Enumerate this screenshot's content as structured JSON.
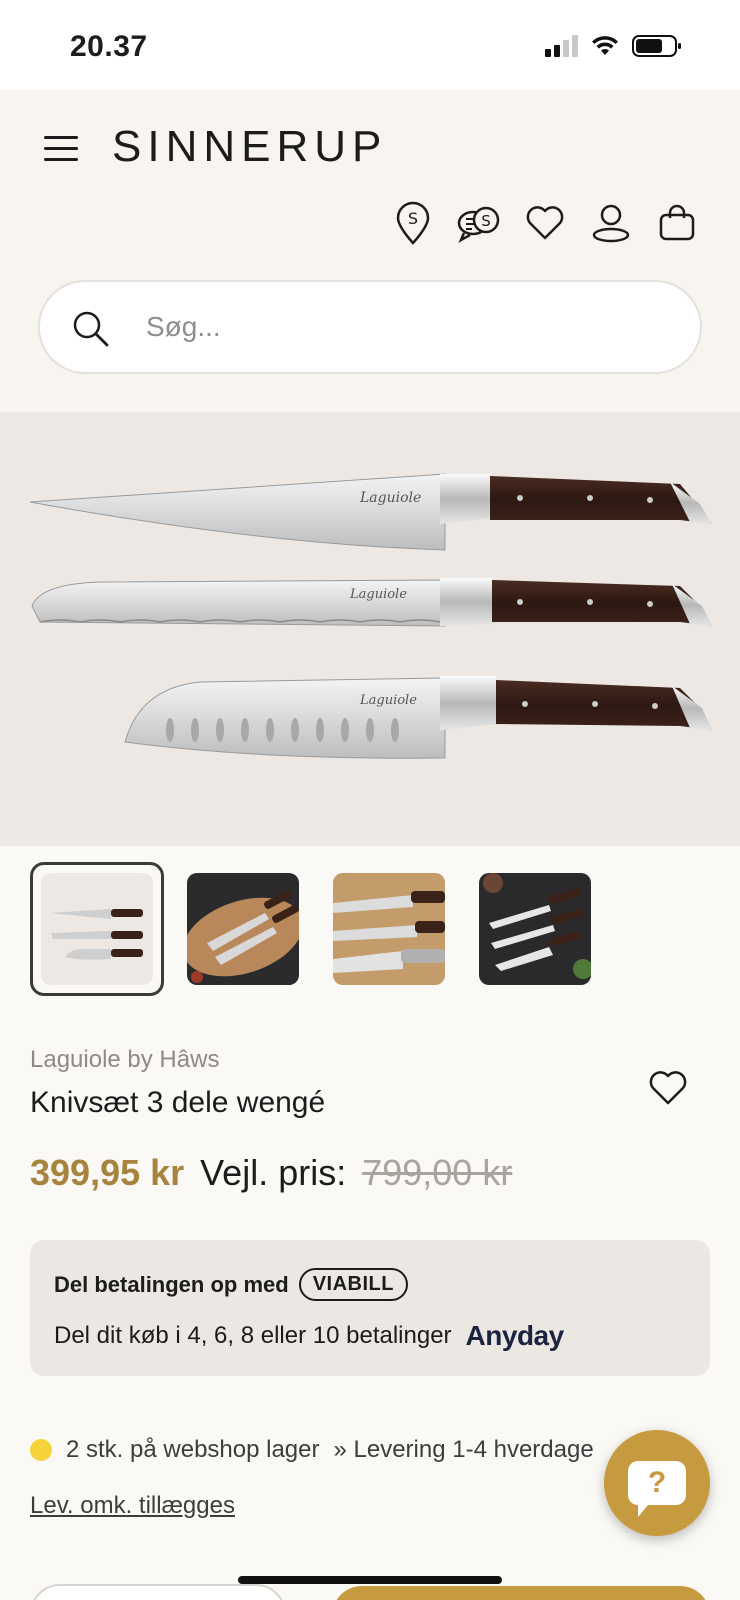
{
  "status_bar": {
    "time": "20.37",
    "icons": [
      "cellular-signal-icon",
      "wifi-icon",
      "battery-icon"
    ]
  },
  "header": {
    "logo": "SINNERUP",
    "icons": [
      "store-locator-icon",
      "chat-support-icon",
      "wishlist-heart-icon",
      "account-icon",
      "shopping-bag-icon"
    ]
  },
  "search": {
    "placeholder": "Søg..."
  },
  "gallery": {
    "thumbnail_count": 4,
    "active_index": 0
  },
  "product": {
    "brand": "Laguiole by Hâws",
    "title": "Knivsæt 3 dele wengé",
    "price": "399,95 kr",
    "rrp_label": "Vejl. pris:",
    "rrp": "799,00 kr"
  },
  "payment": {
    "line1": "Del betalingen op med",
    "viabill": "VIABILL",
    "line2": "Del dit køb i 4, 6, 8 eller 10 betalinger",
    "anyday": "Anyday"
  },
  "stock": {
    "status": "2 stk. på webshop lager",
    "delivery": "» Levering 1-4 hverdage",
    "shipping_link": "Lev. omk. tillægges"
  },
  "help": {
    "label": "?"
  },
  "colors": {
    "accent": "#c69a3e",
    "price": "#a7843e",
    "stock_dot": "#f6d33a"
  }
}
